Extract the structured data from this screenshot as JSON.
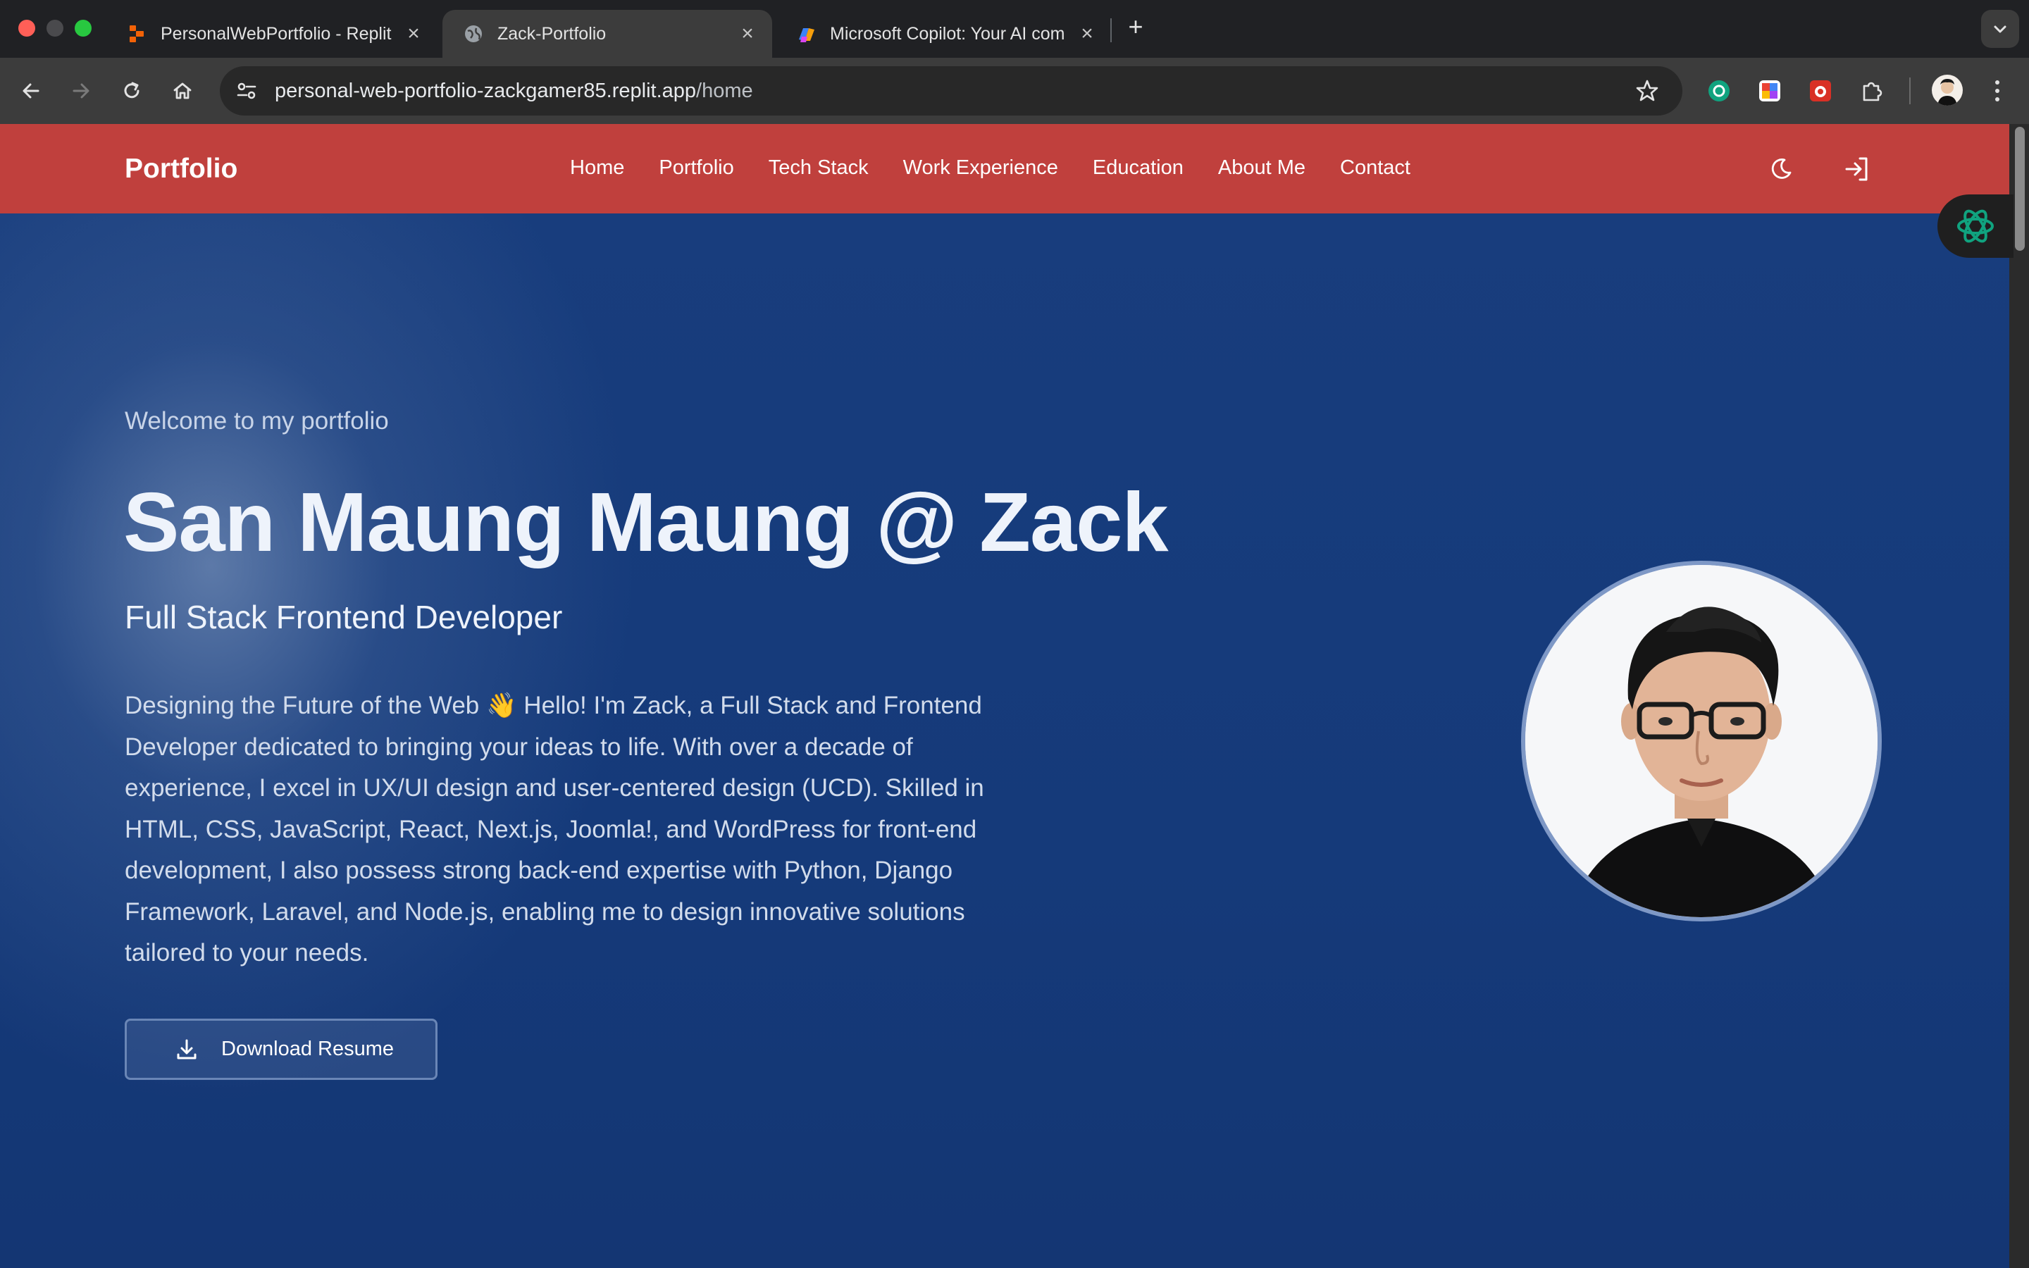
{
  "browser": {
    "tabs": [
      {
        "title": "PersonalWebPortfolio - Replit",
        "favicon": "replit-icon",
        "active": false
      },
      {
        "title": "Zack-Portfolio",
        "favicon": "globe-icon",
        "active": true
      },
      {
        "title": "Microsoft Copilot: Your AI com",
        "favicon": "copilot-icon",
        "active": false
      }
    ],
    "address": {
      "host": "personal-web-portfolio-zackgamer85.replit.app",
      "path": "/home"
    }
  },
  "site": {
    "brand": "Portfolio",
    "nav": [
      "Home",
      "Portfolio",
      "Tech Stack",
      "Work Experience",
      "Education",
      "About Me",
      "Contact"
    ],
    "header_color": "#c0403d"
  },
  "hero": {
    "eyebrow": "Welcome to my portfolio",
    "name": "San Maung Maung @ Zack",
    "role": "Full Stack Frontend Developer",
    "description": "Designing the Future of the Web 👋 Hello! I'm Zack, a Full Stack and Frontend Developer dedicated to bringing your ideas to life. With over a decade of experience, I excel in UX/UI design and user-centered design (UCD). Skilled in HTML, CSS, JavaScript, React, Next.js, Joomla!, and WordPress for front-end development, I also possess strong back-end expertise with Python, Django Framework, Laravel, and Node.js, enabling me to design innovative solutions tailored to your needs.",
    "resume_button": "Download Resume",
    "background_color": "#183d7d"
  }
}
